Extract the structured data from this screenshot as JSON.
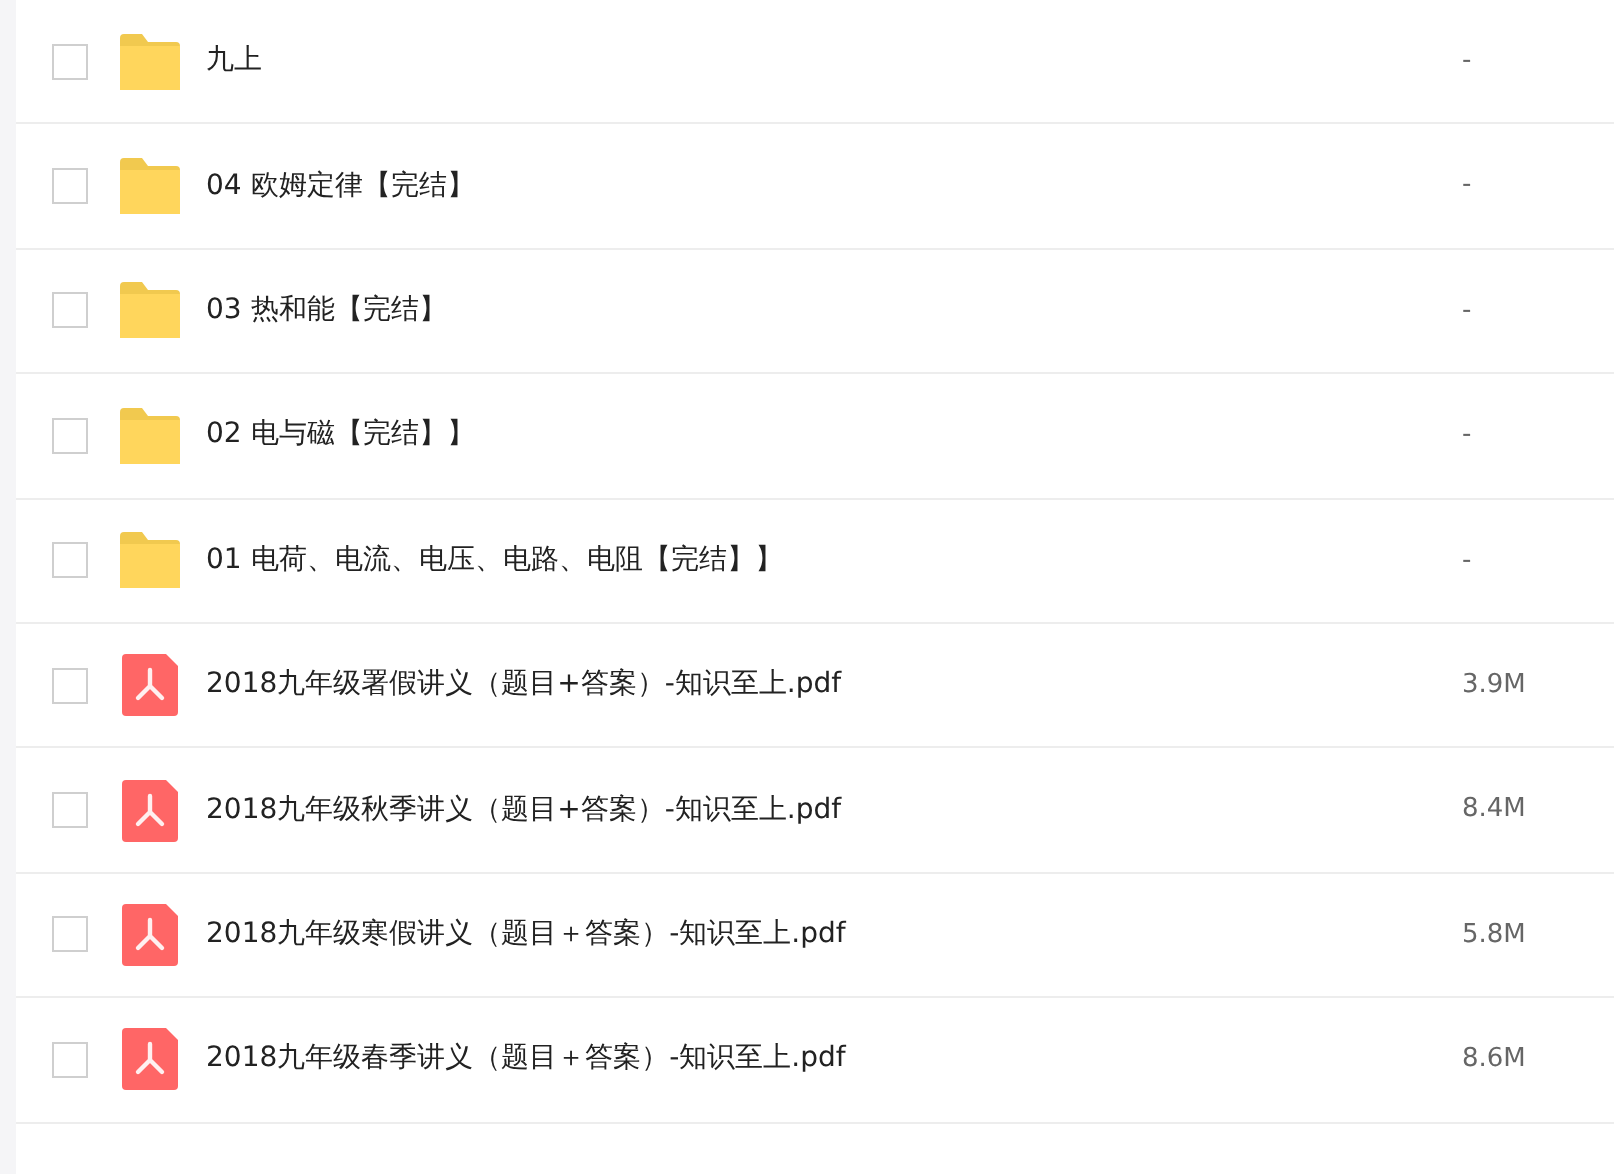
{
  "files": [
    {
      "kind": "folder",
      "name": "九上",
      "size": "-",
      "checked": false
    },
    {
      "kind": "folder",
      "name": "04 欧姆定律【完结】",
      "size": "-",
      "checked": false
    },
    {
      "kind": "folder",
      "name": "03 热和能【完结】",
      "size": "-",
      "checked": false
    },
    {
      "kind": "folder",
      "name": "02 电与磁【完结】】",
      "size": "-",
      "checked": false
    },
    {
      "kind": "folder",
      "name": "01 电荷、电流、电压、电路、电阻【完结】】",
      "size": "-",
      "checked": false
    },
    {
      "kind": "pdf",
      "name": "2018九年级署假讲义（题目+答案）-知识至上.pdf",
      "size": "3.9M",
      "checked": false
    },
    {
      "kind": "pdf",
      "name": "2018九年级秋季讲义（题目+答案）-知识至上.pdf",
      "size": "8.4M",
      "checked": false
    },
    {
      "kind": "pdf",
      "name": "2018九年级寒假讲义（题目＋答案）-知识至上.pdf",
      "size": "5.8M",
      "checked": false
    },
    {
      "kind": "pdf",
      "name": "2018九年级春季讲义（题目＋答案）-知识至上.pdf",
      "size": "8.6M",
      "checked": false
    }
  ]
}
